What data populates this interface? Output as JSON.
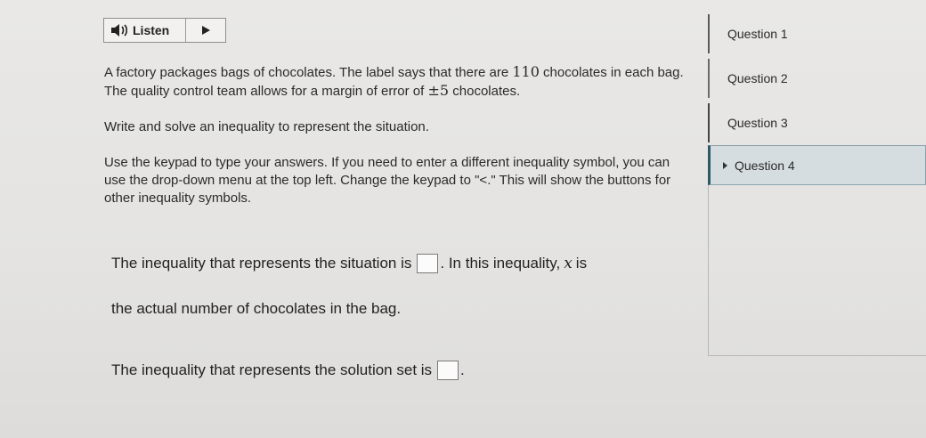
{
  "audio": {
    "listen_label": "Listen",
    "speaker_icon": "speaker-icon",
    "play_icon": "play-icon"
  },
  "question": {
    "p1_pre": "A factory packages bags of chocolates. The label says that there are ",
    "p1_num": "110",
    "p1_mid": " chocolates in each bag. The quality control team allows for a margin of error of ",
    "p1_err": "±5",
    "p1_post": " chocolates.",
    "p2": "Write and solve an inequality to represent the situation.",
    "p3": "Use the keypad to type your answers. If you need to enter a different inequality symbol, you can use the drop-down menu at the top left. Change the keypad to \"<.\" This will show the buttons for other inequality symbols."
  },
  "answers": {
    "line1_pre": "The inequality that represents the situation is",
    "line1_post": ". In this inequality,",
    "line1_var": "x",
    "line1_tail": "is",
    "line2": "the actual number of chocolates in the bag.",
    "line3_pre": "The inequality that represents the solution set is",
    "line3_post": "."
  },
  "sidebar": {
    "items": [
      {
        "label": "Question 1"
      },
      {
        "label": "Question 2"
      },
      {
        "label": "Question 3"
      },
      {
        "label": "Question 4",
        "active": true
      }
    ]
  },
  "colors": {
    "active_bg": "#d6dde0",
    "active_border": "#2f5868"
  }
}
